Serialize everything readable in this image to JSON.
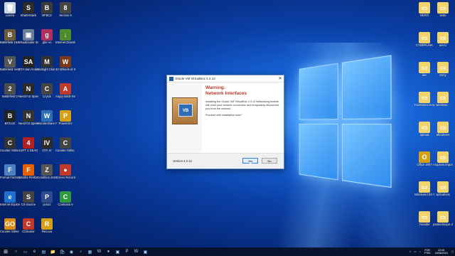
{
  "desktop": {
    "left_icons": [
      {
        "label": "Lixeira",
        "glyph": "🗑",
        "color": "#c9d6e3"
      },
      {
        "label": "SharkAttack",
        "glyph": "S",
        "color": "#2b2b2b"
      },
      {
        "label": "BFBC2",
        "glyph": "B",
        "color": "#3a3a3a"
      },
      {
        "label": "Section 8",
        "glyph": "8",
        "color": "#454545"
      },
      {
        "label": "Battlefield 1942",
        "glyph": "B",
        "color": "#6b5a3a"
      },
      {
        "label": "Visualizador de fotos",
        "glyph": "▣",
        "color": "#6a7d99"
      },
      {
        "label": "gfxr-vn",
        "glyph": "g",
        "color": "#b03060"
      },
      {
        "label": "Internet Downlo...",
        "glyph": "↓",
        "color": "#4f8a2b"
      },
      {
        "label": "Battlefield Vietnam",
        "glyph": "V",
        "color": "#555"
      },
      {
        "label": "GTA San Andreas",
        "glyph": "SA",
        "color": "#222"
      },
      {
        "label": "Midnight Club 2",
        "glyph": "M",
        "color": "#333"
      },
      {
        "label": "10 Wheels of Steel Extre...",
        "glyph": "W",
        "color": "#7a3a1a"
      },
      {
        "label": "Battlefield 2",
        "glyph": "2",
        "color": "#4d4d4d"
      },
      {
        "label": "Need For Speed Und...",
        "glyph": "N",
        "color": "#2a2a2a"
      },
      {
        "label": "Crysis",
        "glyph": "C",
        "color": "#444"
      },
      {
        "label": "Angry Birds Seasons",
        "glyph": "A",
        "color": "#c0392b"
      },
      {
        "label": "BF2142",
        "glyph": "B",
        "color": "#222"
      },
      {
        "label": "Need for Speed Und...",
        "glyph": "N",
        "color": "#333"
      },
      {
        "label": "Wondershare Filmora",
        "glyph": "W",
        "color": "#2d6fb3"
      },
      {
        "label": "PowerISO",
        "glyph": "P",
        "color": "#d4a017"
      },
      {
        "label": "Counter Strike 1.6",
        "glyph": "C",
        "color": "#333"
      },
      {
        "label": "LEFT 4 DEAD",
        "glyph": "4",
        "color": "#b02020"
      },
      {
        "label": "GTA IV",
        "glyph": "IV",
        "color": "#2b2b2b"
      },
      {
        "label": "Counter Strike Wallhack",
        "glyph": "C",
        "color": "#444"
      },
      {
        "label": "Format Factory",
        "glyph": "F",
        "color": "#4a7fc0"
      },
      {
        "label": "Mozilla Firefox",
        "glyph": "F",
        "color": "#e66000"
      },
      {
        "label": "Condition Zero",
        "glyph": "Z",
        "color": "#555"
      },
      {
        "label": "Screen Recorder",
        "glyph": "●",
        "color": "#c0392b"
      },
      {
        "label": "Internet Explorer",
        "glyph": "e",
        "color": "#1f6fd1"
      },
      {
        "label": "CS-Source",
        "glyph": "S",
        "color": "#444"
      },
      {
        "label": "pcsx2",
        "glyph": "P",
        "color": "#2e4a8a"
      },
      {
        "label": "Camtasia 9",
        "glyph": "C",
        "color": "#2f9a3e"
      },
      {
        "label": "Counter Strike Glob...",
        "glyph": "GO",
        "color": "#d98a1a"
      },
      {
        "label": "CCleaner",
        "glyph": "C",
        "color": "#c0392b"
      },
      {
        "label": "Recuva",
        "glyph": "R",
        "color": "#d4a017"
      }
    ],
    "right_icons": [
      {
        "label": "NERO",
        "glyph": "▭",
        "color": "#f2d46b"
      },
      {
        "label": "teste",
        "glyph": "▭",
        "color": "#f2d46b"
      },
      {
        "label": "CYBERLINK",
        "glyph": "▭",
        "color": "#f2d46b"
      },
      {
        "label": "acer1",
        "glyph": "▭",
        "color": "#f2d46b"
      },
      {
        "label": "doc",
        "glyph": "▭",
        "color": "#f2d46b"
      },
      {
        "label": "Sony",
        "glyph": "▭",
        "color": "#f2d46b"
      },
      {
        "label": "Fazedores Eval...",
        "glyph": "▭",
        "color": "#f2d46b"
      },
      {
        "label": "windows...",
        "glyph": "▭",
        "color": "#f2d46b"
      },
      {
        "label": "upload",
        "glyph": "▭",
        "color": "#f2d46b"
      },
      {
        "label": "afiradores",
        "glyph": "▭",
        "color": "#f2d46b"
      },
      {
        "label": "Office 2007",
        "glyph": "O",
        "color": "#d4a017"
      },
      {
        "label": "Arquivos importantes",
        "glyph": "▭",
        "color": "#f2d46b"
      },
      {
        "label": "Windows ISO Downloader",
        "glyph": "▭",
        "color": "#f2d46b"
      },
      {
        "label": "aplicativos",
        "glyph": "▭",
        "color": "#f2d46b"
      },
      {
        "label": "Youtube",
        "glyph": "▭",
        "color": "#f2d46b"
      },
      {
        "label": "paraschoque do vectra",
        "glyph": "▭",
        "color": "#f2d46b"
      }
    ]
  },
  "dialog": {
    "title": "Oracle VM VirtualBox 4.3.12",
    "close": "✕",
    "heading_line1": "Warning:",
    "heading_line2": "Network Interfaces",
    "message": "Installing the Oracle VM VirtualBox 4.3.12 Networking feature will reset your network connection and temporarily disconnect you from the network.",
    "question": "Proceed with installation now?",
    "version": "Version 4.3.12",
    "yes_label": "Yes",
    "no_label": "No",
    "box_logo": "VB"
  },
  "taskbar": {
    "start": "⊞",
    "items": [
      "○",
      "▭",
      "e",
      "▤",
      "📁",
      "🛍",
      "◉",
      "♪",
      "▦",
      "W",
      "●",
      "▣",
      "P",
      "W",
      "▣"
    ],
    "tray_lang1": "POR",
    "tray_lang2": "PTB2",
    "time": "22:05",
    "date": "15/06/2018"
  }
}
